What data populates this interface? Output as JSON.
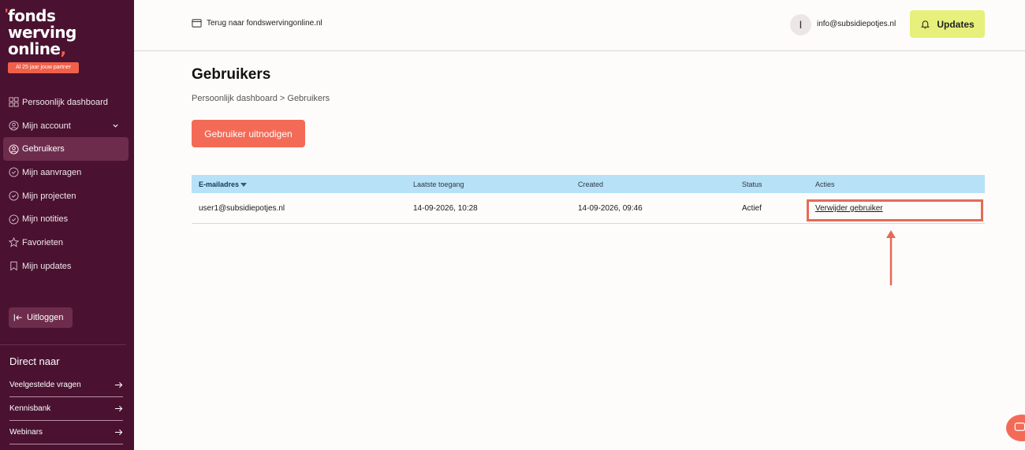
{
  "logo": {
    "line1": "fonds",
    "line2": "werving",
    "line3": "online",
    "badge": "Al 25 jaar jouw partner"
  },
  "sidebar": {
    "items": [
      {
        "label": "Persoonlijk dashboard",
        "icon": "grid-icon"
      },
      {
        "label": "Mijn account",
        "icon": "user-circle-icon"
      },
      {
        "label": "Gebruikers",
        "icon": "users-circle-icon"
      },
      {
        "label": "Mijn aanvragen",
        "icon": "check-circle-icon"
      },
      {
        "label": "Mijn projecten",
        "icon": "check-circle-icon"
      },
      {
        "label": "Mijn notities",
        "icon": "check-circle-icon"
      },
      {
        "label": "Favorieten",
        "icon": "star-icon"
      },
      {
        "label": "Mijn updates",
        "icon": "bookmark-icon"
      }
    ],
    "logout": "Uitloggen",
    "direct_title": "Direct naar",
    "direct_links": [
      {
        "label": "Veelgestelde vragen"
      },
      {
        "label": "Kennisbank"
      },
      {
        "label": "Webinars"
      }
    ]
  },
  "topbar": {
    "back_link": "Terug naar fondswervingonline.nl",
    "avatar_initial": "I",
    "user_email": "info@subsidiepotjes.nl",
    "updates_label": "Updates"
  },
  "main": {
    "title": "Gebruikers",
    "breadcrumb": "Persoonlijk dashboard > Gebruikers",
    "invite_button": "Gebruiker uitnodigen",
    "table": {
      "columns": [
        "E-mailadres",
        "Laatste toegang",
        "Created",
        "Status",
        "Acties"
      ],
      "rows": [
        {
          "email": "user1@subsidiepotjes.nl",
          "last_access": "14-09-2026, 10:28",
          "created": "14-09-2026, 09:46",
          "status": "Actief",
          "action": "Verwijder gebruiker"
        }
      ]
    }
  },
  "colors": {
    "sidebar_bg": "#4a1230",
    "accent": "#f36b57",
    "updates_bg": "#e6f07a",
    "table_header_bg": "#b7e1f7",
    "highlight": "#e66a55"
  }
}
